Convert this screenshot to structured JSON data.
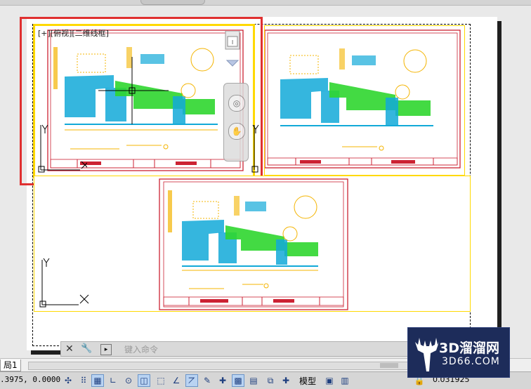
{
  "viewport_label": "[+][俯视][二维线框]",
  "command_line": {
    "placeholder": "键入命令"
  },
  "layout_tabs": [
    "局1"
  ],
  "status": {
    "coordinates": ".3975, 0.0000",
    "model_label": "模型",
    "scale": "0.031925"
  },
  "watermark": {
    "brand": "3D溜溜网",
    "url": "3D66.COM"
  },
  "colors": {
    "viewport_border": "#ffd900",
    "active_highlight": "#e03030",
    "drawing_frame": "#cc2233",
    "hatch_cyan": "#12a9d8",
    "hatch_green": "#2fd62f",
    "annotation_yellow": "#f4b400"
  }
}
